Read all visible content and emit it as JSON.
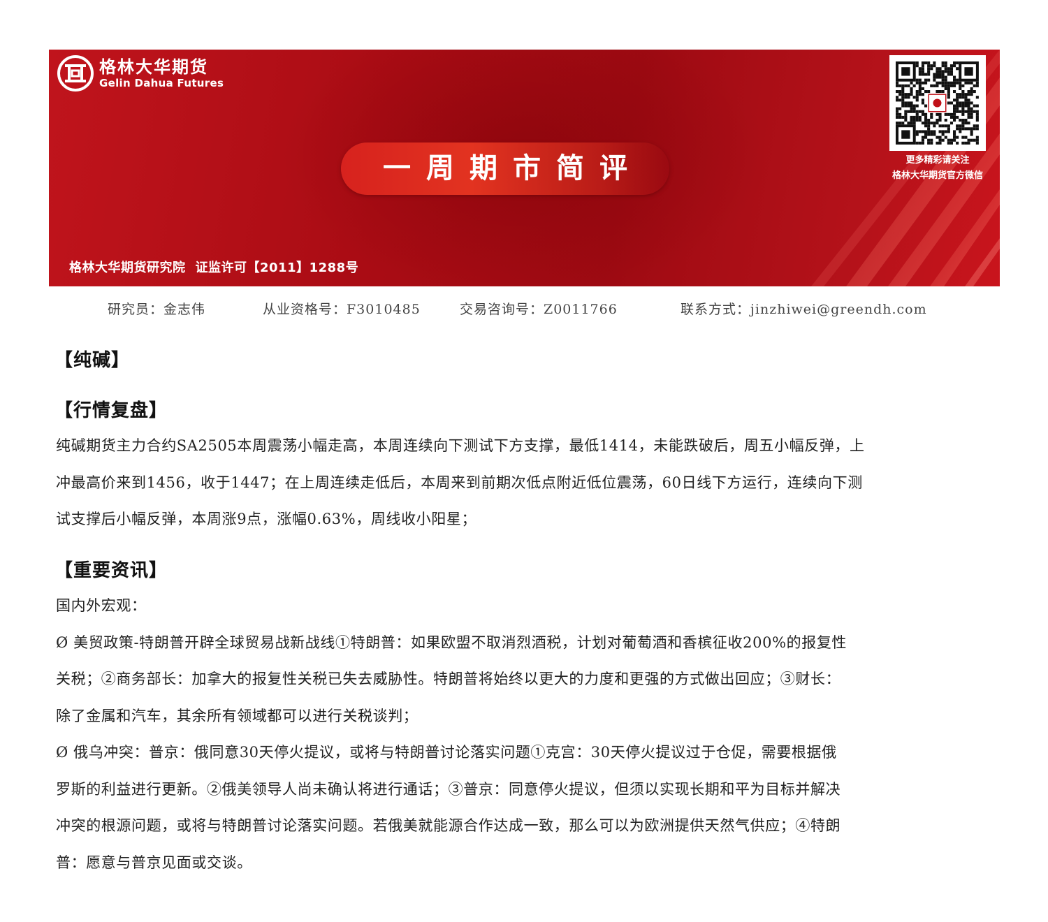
{
  "banner": {
    "logo_cn": "格林大华期货",
    "logo_en": "Gelin Dahua Futures",
    "title": "一周期市简评",
    "qr_caption_1": "更多精彩请关注",
    "qr_caption_2": "格林大华期货官方微信",
    "org": "格林大华期货研究院",
    "license": "证监许可【2011】1288号",
    "colors": {
      "brand_red": "#b00e16",
      "accent_red": "#e23320",
      "text": "#ffffff"
    }
  },
  "analyst": {
    "researcher": "研究员：金志伟",
    "qualification": "从业资格号：F3010485",
    "consult": "交易咨询号：Z0011766",
    "contact": "联系方式：jinzhiwei@greendh.com"
  },
  "sections": {
    "product": "【纯碱】",
    "review_heading": "【行情复盘】",
    "review_lines": [
      "纯碱期货主力合约SA2505本周震荡小幅走高，本周连续向下测试下方支撑，最低1414，未能跌破后，周五小幅反弹，上",
      "冲最高价来到1456，收于1447；在上周连续走低后，本周来到前期次低点附近低位震荡，60日线下方运行，连续向下测",
      "试支撑后小幅反弹，本周涨9点，涨幅0.63%，周线收小阳星；"
    ],
    "news_heading": "【重要资讯】",
    "news_lines": [
      "国内外宏观：",
      "Ø 美贸政策-特朗普开辟全球贸易战新战线①特朗普：如果欧盟不取消烈酒税，计划对葡萄酒和香槟征收200%的报复性",
      "关税；②商务部长：加拿大的报复性关税已失去威胁性。特朗普将始终以更大的力度和更强的方式做出回应；③财长：",
      "除了金属和汽车，其余所有领域都可以进行关税谈判；",
      "Ø 俄乌冲突：普京：俄同意30天停火提议，或将与特朗普讨论落实问题①克宫：30天停火提议过于仓促，需要根据俄",
      "罗斯的利益进行更新。②俄美领导人尚未确认将进行通话；③普京：同意停火提议，但须以实现长期和平为目标并解决",
      "冲突的根源问题，或将与特朗普讨论落实问题。若俄美就能源合作达成一致，那么可以为欧洲提供天然气供应；④特朗",
      "普：愿意与普京见面或交谈。"
    ]
  }
}
